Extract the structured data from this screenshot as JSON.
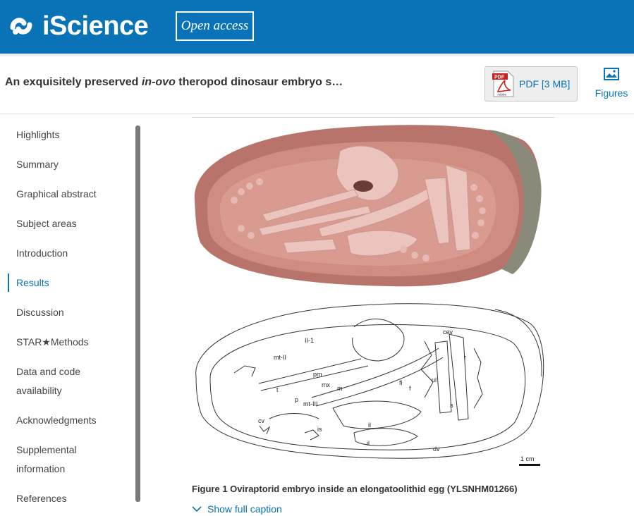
{
  "header": {
    "brand": "iScience",
    "badge": "Open access"
  },
  "article": {
    "title_before": "An exquisitely preserved ",
    "title_italic": "in-ovo",
    "title_after": " theropod dinosaur embryo s…",
    "pdf_label": "PDF [3 MB]",
    "figures_label": "Figures"
  },
  "sidebar": {
    "items": [
      {
        "label": "Highlights"
      },
      {
        "label": "Summary"
      },
      {
        "label": "Graphical abstract"
      },
      {
        "label": "Subject areas"
      },
      {
        "label": "Introduction"
      },
      {
        "label": "Results",
        "active": true
      },
      {
        "label": "Discussion"
      },
      {
        "label": "STAR★Methods"
      },
      {
        "label": "Data and code availability"
      },
      {
        "label": "Acknowledgments"
      },
      {
        "label": "Supplemental information"
      },
      {
        "label": "References"
      }
    ]
  },
  "figure": {
    "caption": "Figure 1 Oviraptorid embryo inside an elongatoolithid egg (YLSNHM01266)",
    "show_caption": "Show full caption",
    "scale_label": "1 cm",
    "labels": [
      "cev",
      "r",
      "II-1",
      "mt-II",
      "pm",
      "mx",
      "m",
      "t",
      "p",
      "mt-III",
      "fi",
      "f",
      "ul",
      "s",
      "cv",
      "is",
      "il",
      "il",
      "dv"
    ]
  },
  "colors": {
    "brand_blue": "#0a73b7",
    "egg_shell": "#c98373",
    "bone": "#e7b9b4"
  }
}
